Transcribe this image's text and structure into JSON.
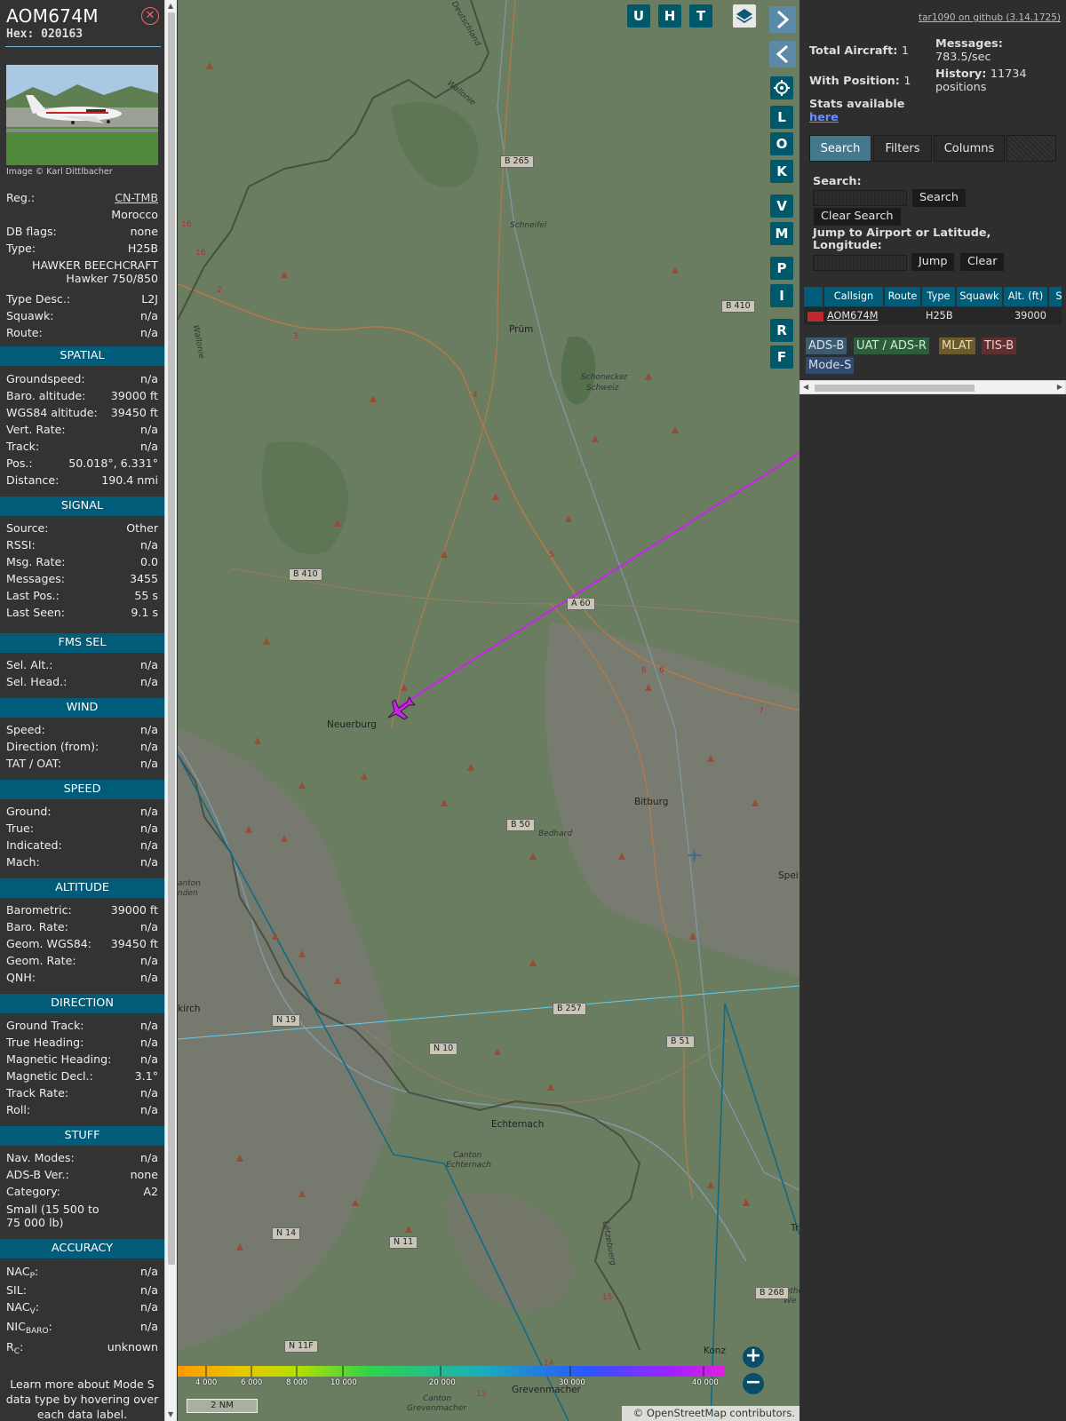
{
  "aircraft": {
    "callsign": "AOM674M",
    "hex_label": "Hex: 020163",
    "photo_credit": "Image © Karl Dittlbacher",
    "rows": [
      {
        "label": "Reg.:",
        "value": "CN-TMB"
      },
      {
        "label": "",
        "value": "Morocco"
      },
      {
        "label": "DB flags:",
        "value": "none"
      },
      {
        "label": "Type:",
        "value": "H25B"
      },
      {
        "label": "Type Desc.:",
        "value": "L2J"
      },
      {
        "label": "Squawk:",
        "value": "n/a"
      },
      {
        "label": "Route:",
        "value": "n/a"
      }
    ],
    "type_name_1": "HAWKER BEECHCRAFT",
    "type_name_2": "Hawker 750/850"
  },
  "sections": {
    "spatial": {
      "title": "SPATIAL",
      "rows": [
        {
          "label": "Groundspeed:",
          "value": "n/a"
        },
        {
          "label": "Baro. altitude:",
          "value": "39000 ft"
        },
        {
          "label": "WGS84 altitude:",
          "value": "39450 ft"
        },
        {
          "label": "Vert. Rate:",
          "value": "n/a"
        },
        {
          "label": "Track:",
          "value": "n/a"
        },
        {
          "label": "Pos.:",
          "value": "50.018°, 6.331°"
        },
        {
          "label": "Distance:",
          "value": "190.4 nmi"
        }
      ]
    },
    "signal": {
      "title": "SIGNAL",
      "rows": [
        {
          "label": "Source:",
          "value": "Other"
        },
        {
          "label": "RSSI:",
          "value": "n/a"
        },
        {
          "label": "Msg. Rate:",
          "value": "0.0"
        },
        {
          "label": "Messages:",
          "value": "3455"
        },
        {
          "label": "Last Pos.:",
          "value": "55 s"
        },
        {
          "label": "Last Seen:",
          "value": "9.1 s"
        }
      ]
    },
    "fms": {
      "title": "FMS SEL",
      "rows": [
        {
          "label": "Sel. Alt.:",
          "value": "n/a"
        },
        {
          "label": "Sel. Head.:",
          "value": "n/a"
        }
      ]
    },
    "wind": {
      "title": "WIND",
      "rows": [
        {
          "label": "Speed:",
          "value": "n/a"
        },
        {
          "label": "Direction (from):",
          "value": "n/a"
        },
        {
          "label": "TAT / OAT:",
          "value": "n/a"
        }
      ]
    },
    "speed": {
      "title": "SPEED",
      "rows": [
        {
          "label": "Ground:",
          "value": "n/a"
        },
        {
          "label": "True:",
          "value": "n/a"
        },
        {
          "label": "Indicated:",
          "value": "n/a"
        },
        {
          "label": "Mach:",
          "value": "n/a"
        }
      ]
    },
    "altitude": {
      "title": "ALTITUDE",
      "rows": [
        {
          "label": "Barometric:",
          "value": "39000 ft"
        },
        {
          "label": "Baro. Rate:",
          "value": "n/a"
        },
        {
          "label": "Geom. WGS84:",
          "value": "39450 ft"
        },
        {
          "label": "Geom. Rate:",
          "value": "n/a"
        },
        {
          "label": "QNH:",
          "value": "n/a"
        }
      ]
    },
    "direction": {
      "title": "DIRECTION",
      "rows": [
        {
          "label": "Ground Track:",
          "value": "n/a"
        },
        {
          "label": "True Heading:",
          "value": "n/a"
        },
        {
          "label": "Magnetic Heading:",
          "value": "n/a"
        },
        {
          "label": "Magnetic Decl.:",
          "value": "3.1°"
        },
        {
          "label": "Track Rate:",
          "value": "n/a"
        },
        {
          "label": "Roll:",
          "value": "n/a"
        }
      ]
    },
    "stuff": {
      "title": "STUFF",
      "rows": [
        {
          "label": "Nav. Modes:",
          "value": "n/a"
        },
        {
          "label": "ADS-B Ver.:",
          "value": "none"
        },
        {
          "label": "Category:",
          "value": "A2"
        }
      ],
      "category_desc_1": "Small (15 500 to",
      "category_desc_2": "75 000 lb)"
    },
    "accuracy": {
      "title": "ACCURACY",
      "nacp_label": "NAC",
      "nacp_sub": "P",
      "nacp_value": "n/a",
      "sil_label": "SIL:",
      "sil_value": "n/a",
      "nacv_label": "NAC",
      "nacv_sub": "V",
      "nacv_value": "n/a",
      "nic_label": "NIC",
      "nic_sub": "BARO",
      "nic_value": "n/a",
      "rc_label": "R",
      "rc_sub": "C",
      "rc_value": "unknown"
    },
    "footnote_1": "Learn more about Mode S",
    "footnote_2": "data type by hovering over",
    "footnote_3": "each data label."
  },
  "map": {
    "buttons_top": [
      "U",
      "H",
      "T"
    ],
    "buttons_side": [
      "L",
      "O",
      "K",
      "V",
      "M",
      "P",
      "I",
      "R",
      "F"
    ],
    "labels": {
      "pruem": "Prüm",
      "neuerburg": "Neuerburg",
      "bitburg": "Bitburg",
      "echternach": "Echternach",
      "grevenmacher": "Grevenmacher",
      "konz": "Konz",
      "schneifel": "Schneifel",
      "schonecker": "Schonecker",
      "schweiz": "Schweiz",
      "bedhard": "Bedhard",
      "canton_ech_1": "Canton",
      "canton_ech_2": "Echternach",
      "canton_grev_1": "Canton",
      "canton_grev_2": "Grevenmacher",
      "kirch": "kirch",
      "spei": "Spei",
      "wallonie_1": "Wallonie",
      "wallonie_2": "Wallonie",
      "deutschland": "Deutschland",
      "letzebuerg": "Lëtzebuerg",
      "canton_w_1": "anton",
      "canton_w_2": "nden",
      "mathe_1": "Mathe",
      "mathe_2": "We",
      "tr": "Tr"
    },
    "road_badges": {
      "b265": "B 265",
      "b410a": "B 410",
      "b410b": "B 410",
      "a60": "A 60",
      "b50": "B 50",
      "b257": "B 257",
      "n19": "N 19",
      "n10": "N 10",
      "b51": "B 51",
      "n14": "N 14",
      "n11": "N 11",
      "n11f": "N 11F",
      "b268": "B 268"
    },
    "road_numbers": {
      "r16a": "16",
      "r16b": "16",
      "r2": "2",
      "r3": "3",
      "r4": "4",
      "r5": "5",
      "r6a": "6",
      "r6b": "6",
      "r7": "7",
      "r13": "13",
      "r14": "14",
      "r15": "15",
      "r3b": "3"
    },
    "altitude_ticks": [
      "4 000",
      "6 000",
      "8 000",
      "10 000",
      "20 000",
      "30 000",
      "40 000"
    ],
    "scale_label": "2 NM",
    "attribution": "© OpenStreetMap contributors.",
    "zoom_in": "+",
    "zoom_out": "−"
  },
  "sidebar": {
    "github_link": "tar1090 on github (3.14.1725)",
    "total_aircraft_label": "Total Aircraft:",
    "total_aircraft_value": "1",
    "messages_label": "Messages:",
    "messages_value": "783.5/sec",
    "with_position_label": "With Position:",
    "with_position_value": "1",
    "history_label": "History:",
    "history_value": "11734",
    "history_unit": "positions",
    "stats_label": "Stats available",
    "stats_link": "here",
    "tabs": [
      "Search",
      "Filters",
      "Columns"
    ],
    "search_label": "Search:",
    "search_button": "Search",
    "clear_search_button": "Clear Search",
    "jump_label_1": "Jump to Airport or Latitude,",
    "jump_label_2": "Longitude:",
    "jump_button": "Jump",
    "clear_button": "Clear",
    "table": {
      "headers": [
        "Callsign",
        "Route",
        "Type",
        "Squawk",
        "Alt. (ft)",
        "Sp"
      ],
      "row": {
        "callsign": "AOM674M",
        "route": "",
        "type": "H25B",
        "squawk": "",
        "alt": "39000"
      }
    },
    "badges": [
      "ADS-B",
      "UAT / ADS-R",
      "MLAT",
      "TIS-B",
      "Mode-S"
    ]
  },
  "colors": {
    "section_header": "#005c78",
    "track_line": "#cc22ee",
    "map_button": "#00596b"
  }
}
